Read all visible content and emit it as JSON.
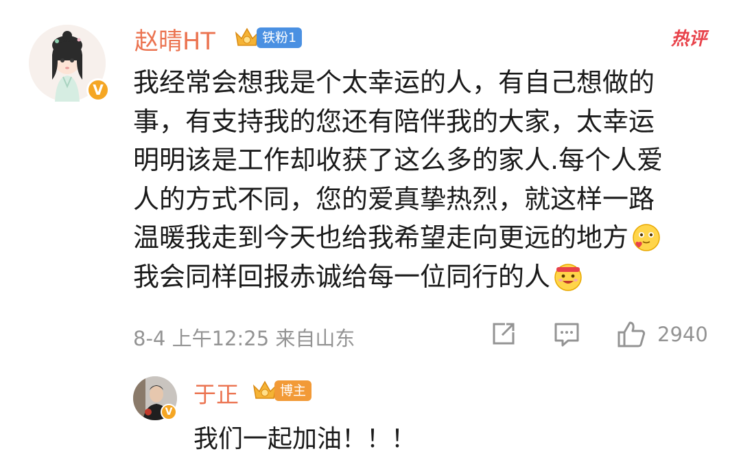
{
  "comment": {
    "username": "赵晴HT",
    "fan_badge": "铁粉1",
    "hot_label": "热评",
    "verified_mark": "V",
    "lines": [
      "我经常会想我是个太幸运的人，有自己想做的",
      "事，有支持我的您还有陪伴我的大家，太幸运",
      "明明该是工作却收获了这么多的家人.每个人爱",
      "人的方式不同，您的爱真挚热烈，就这样一路",
      "温暖我走到今天也给我希望走向更远的地方",
      "我会同样回报赤诚给每一位同行的人"
    ],
    "emojis": [
      "in-love-face-emoji",
      "cheering-face-emoji"
    ],
    "date": "8-4",
    "time": "上午12:25",
    "source": "来自山东",
    "like_count": "2940"
  },
  "reply": {
    "username": "于正",
    "badge": "博主",
    "verified_mark": "V",
    "text": "我们一起加油！！！"
  },
  "colors": {
    "username": "#eb7350",
    "hot": "#e8424a",
    "meta": "#939393",
    "fan_pill": "#4a90e2",
    "host_pill": "#f29a37",
    "verified": "#f5a623"
  },
  "icons": [
    "share-icon",
    "comment-icon",
    "like-icon",
    "crown-icon"
  ]
}
